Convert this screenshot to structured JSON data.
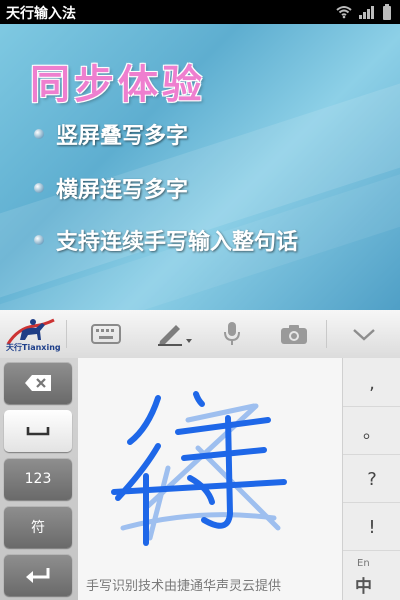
{
  "status_bar": {
    "app_title": "天行输入法",
    "icons": [
      "wifi-icon",
      "signal-icon",
      "battery-icon"
    ]
  },
  "promo": {
    "title": "同步体验",
    "features": [
      "竖屏叠写多字",
      "横屏连写多字",
      "支持连续手写输入整句话"
    ]
  },
  "toolbar": {
    "logo_text": "天行Tianxing",
    "items": [
      "keyboard-icon",
      "pen-icon",
      "microphone-icon",
      "camera-icon",
      "chevron-down-icon"
    ]
  },
  "left_keys": {
    "number_label": "123",
    "symbol_label": "符",
    "icons": [
      "backspace-icon",
      "space-icon",
      "enter-icon"
    ]
  },
  "handwriting": {
    "recognized_char": "符",
    "hint": "手写识别技术由捷通华声灵云提供"
  },
  "punctuation": [
    ",",
    "。",
    "?",
    "!"
  ],
  "language": {
    "en_label": "En",
    "zh_label": "中"
  },
  "colors": {
    "title_pink": "#ee7fcf",
    "ink_blue": "#1e67e8",
    "ink_light_blue": "#8fb6ee"
  }
}
